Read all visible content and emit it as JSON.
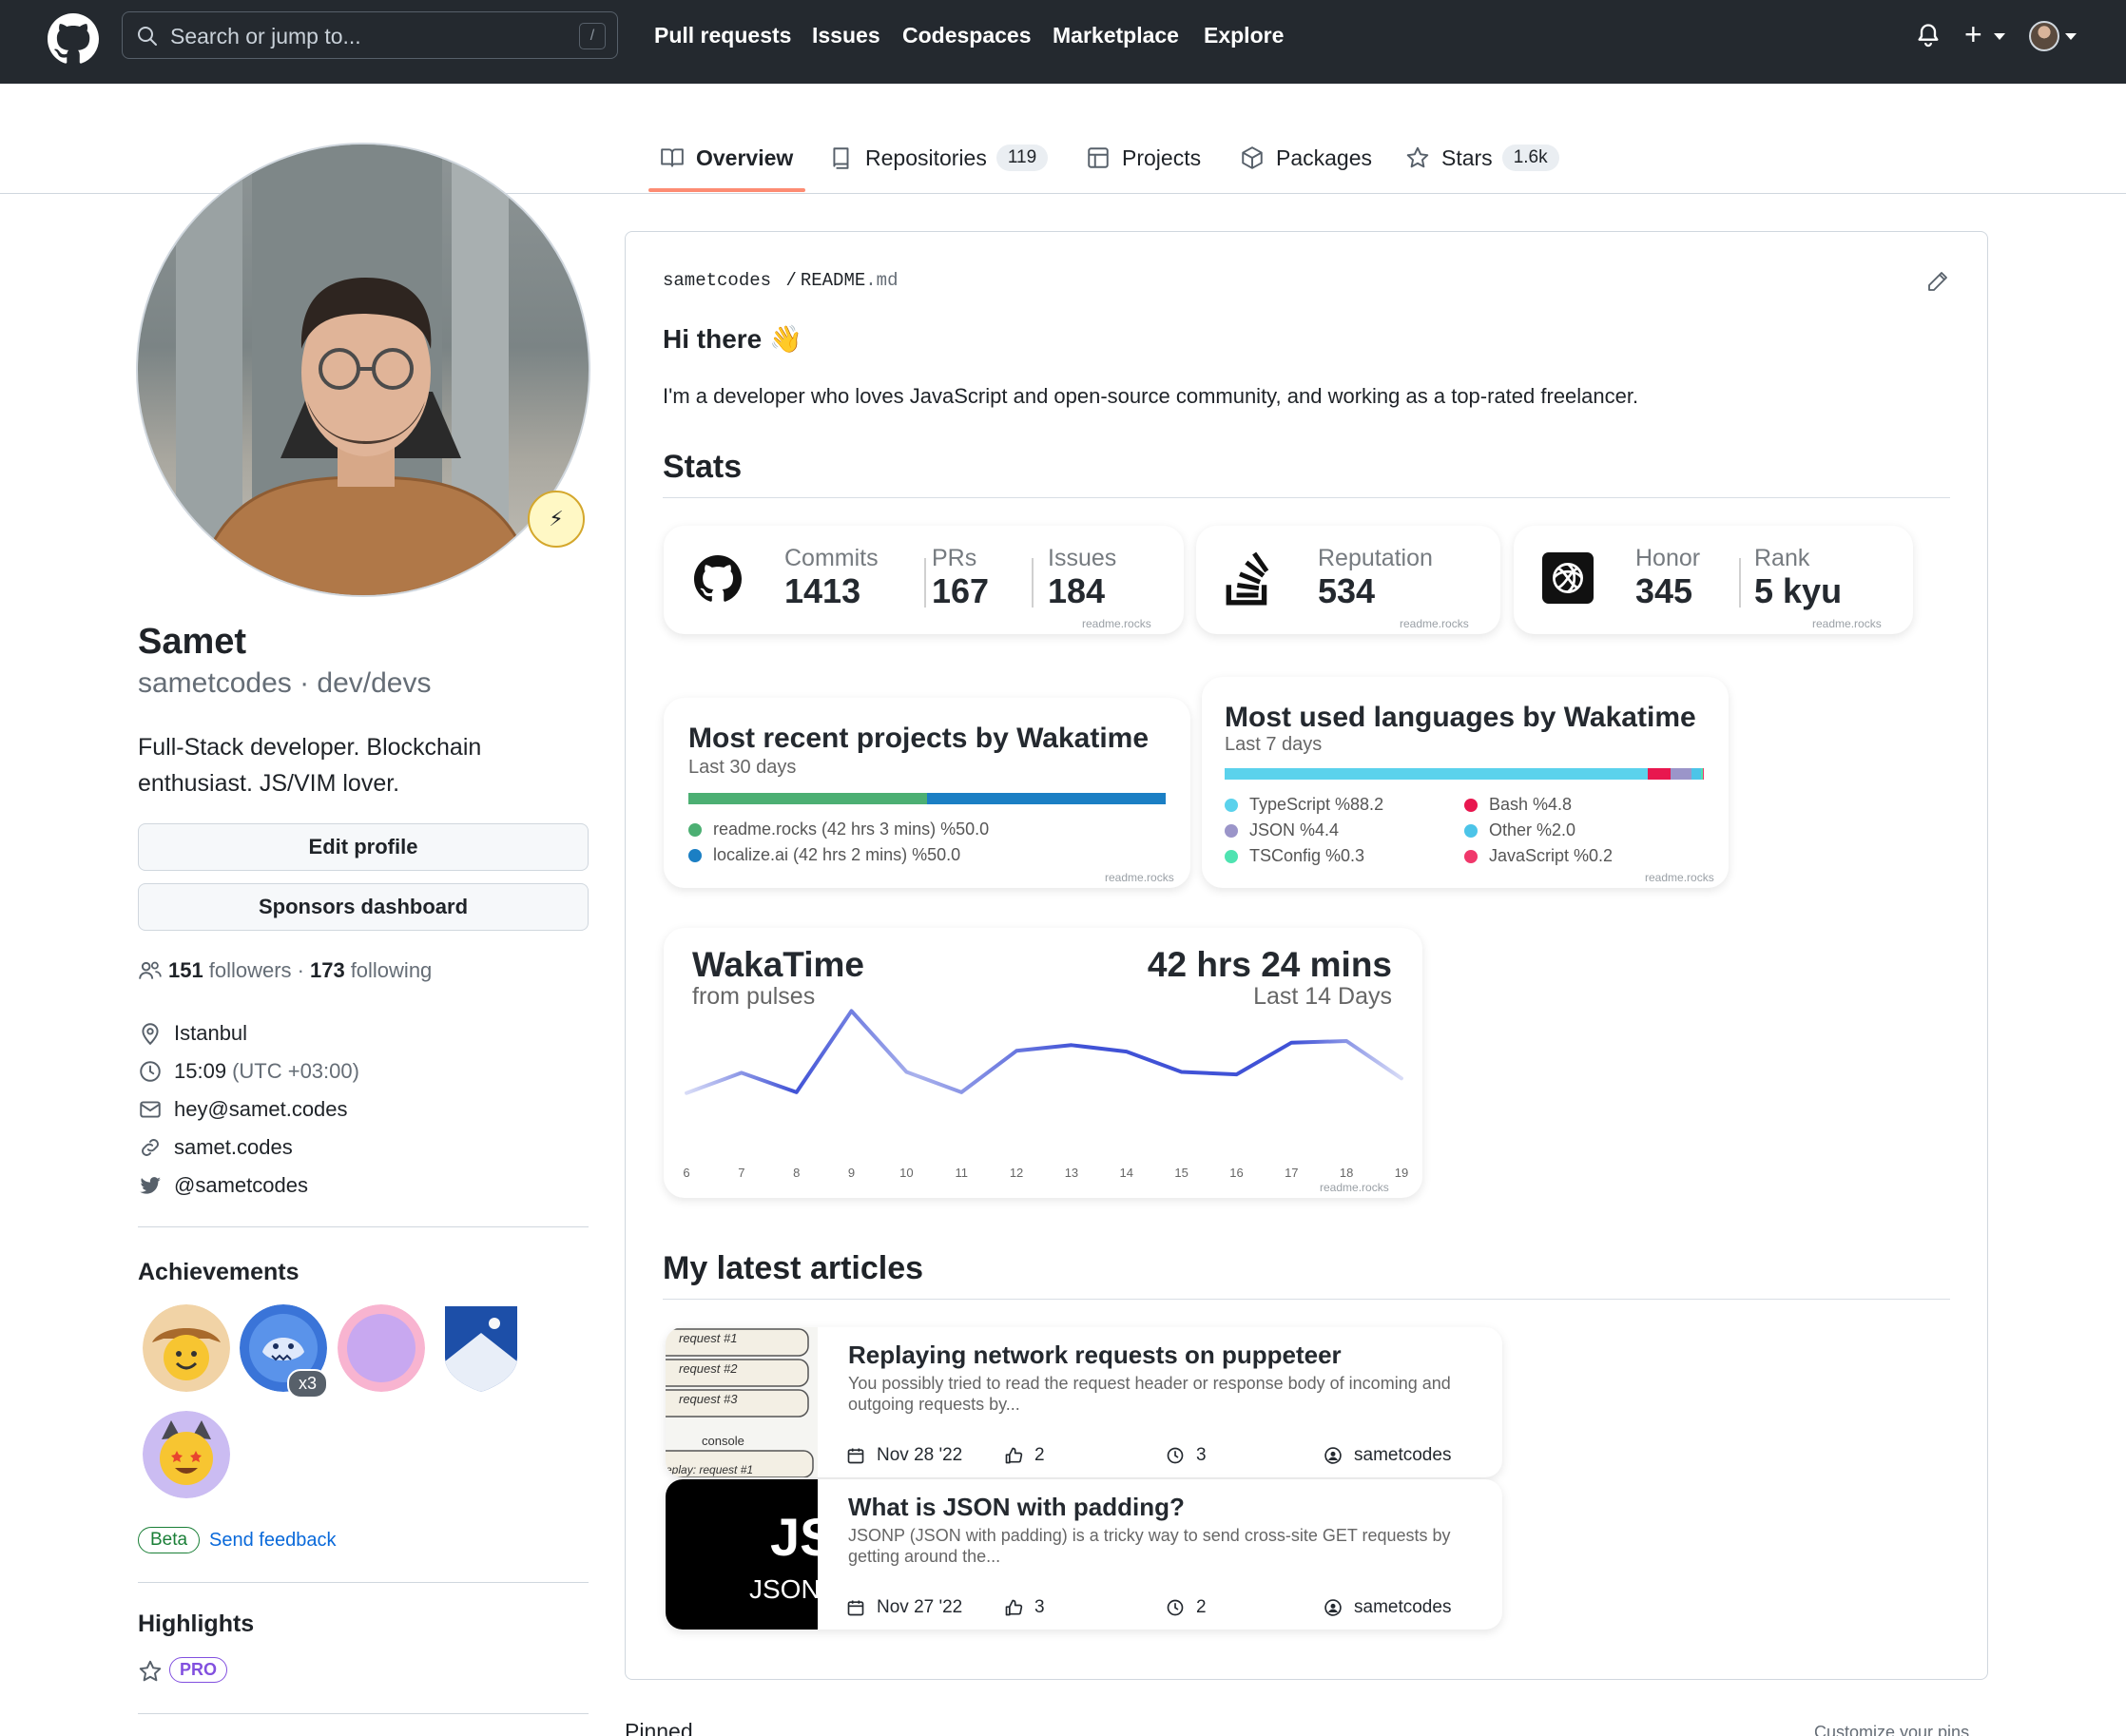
{
  "header": {
    "search_placeholder": "Search or jump to...",
    "slash": "/",
    "nav": [
      "Pull requests",
      "Issues",
      "Codespaces",
      "Marketplace",
      "Explore"
    ],
    "plus": "+"
  },
  "tabs": [
    {
      "label": "Overview"
    },
    {
      "label": "Repositories",
      "count": "119"
    },
    {
      "label": "Projects"
    },
    {
      "label": "Packages"
    },
    {
      "label": "Stars",
      "count": "1.6k"
    }
  ],
  "profile": {
    "name": "Samet",
    "login": "sametcodes · dev/devs",
    "bio": "Full-Stack developer. Blockchain enthusiast. JS/VIM lover.",
    "edit_button": "Edit profile",
    "sponsors_button": "Sponsors dashboard",
    "followers": "151",
    "followers_label": "followers ·",
    "following": "173",
    "following_label": "following",
    "location": "Istanbul",
    "time": "15:09",
    "timezone": "(UTC +03:00)",
    "email": "hey@samet.codes",
    "website": "samet.codes",
    "twitter": "@sametcodes",
    "status_emoji": "⚡"
  },
  "achievements": {
    "title": "Achievements",
    "x3": "x3",
    "beta": "Beta",
    "feedback": "Send feedback"
  },
  "highlights": {
    "title": "Highlights",
    "pro": "PRO"
  },
  "readme": {
    "owner": "sametcodes",
    "sep": "/",
    "file": "README",
    "ext": ".md",
    "greeting": "Hi there 👋",
    "intro": "I'm a developer who loves JavaScript and open-source community, and working as a top-rated freelancer.",
    "stats_heading": "Stats",
    "articles_heading": "My latest articles"
  },
  "stats": {
    "github": [
      {
        "label": "Commits",
        "value": "1413"
      },
      {
        "label": "PRs",
        "value": "167"
      },
      {
        "label": "Issues",
        "value": "184"
      }
    ],
    "stackoverflow": [
      {
        "label": "Reputation",
        "value": "534"
      }
    ],
    "codewars": [
      {
        "label": "Honor",
        "value": "345"
      },
      {
        "label": "Rank",
        "value": "5 kyu"
      }
    ],
    "credit": "readme.rocks"
  },
  "wakatime_projects": {
    "title": "Most recent projects by Wakatime",
    "subtitle": "Last 30 days",
    "items": [
      {
        "label": "readme.rocks (42 hrs 3 mins) %50.0",
        "color": "#4caf73",
        "share": 50.0
      },
      {
        "label": "localize.ai (42 hrs 2 mins) %50.0",
        "color": "#1b7fc4",
        "share": 50.0
      }
    ]
  },
  "wakatime_languages": {
    "title": "Most used languages by Wakatime",
    "subtitle": "Last 7 days",
    "items": [
      {
        "label": "TypeScript %88.2",
        "color": "#5bd2ec",
        "share": 88.2
      },
      {
        "label": "Bash %4.8",
        "color": "#e8174f",
        "share": 4.8
      },
      {
        "label": "JSON %4.4",
        "color": "#9b95c9",
        "share": 4.4
      },
      {
        "label": "Other %2.0",
        "color": "#4cc4e8",
        "share": 2.0
      },
      {
        "label": "TSConfig %0.3",
        "color": "#4fe3b1",
        "share": 0.3
      },
      {
        "label": "JavaScript %0.2",
        "color": "#f0386b",
        "share": 0.2
      }
    ]
  },
  "chart_data": {
    "type": "line",
    "title": "WakaTime",
    "subtitle": "from pulses",
    "total": "42 hrs 24 mins",
    "period": "Last 14 Days",
    "x": [
      6,
      7,
      8,
      9,
      10,
      11,
      12,
      13,
      14,
      15,
      16,
      17,
      18,
      19
    ],
    "values": [
      0.5,
      3.0,
      0.6,
      10.6,
      3.1,
      0.6,
      5.7,
      6.4,
      5.6,
      3.1,
      2.8,
      6.7,
      6.9,
      2.3
    ],
    "ylim": [
      0,
      11
    ],
    "color": "#4052d6",
    "credit": "readme.rocks"
  },
  "articles": [
    {
      "title": "Replaying network requests on puppeteer",
      "desc": "You possibly tried to read the request header or response body of incoming and outgoing requests by...",
      "date": "Nov 28 '22",
      "likes": "2",
      "minutes": "3",
      "author": "sametcodes",
      "thumb": [
        "request #1",
        "request #2",
        "request #3",
        "console",
        "eplay: request #1"
      ]
    },
    {
      "title": "What is JSON with padding?",
      "desc": "JSONP (JSON with padding) is a tricky way to send cross-site GET requests by getting around the...",
      "date": "Nov 27 '22",
      "likes": "3",
      "minutes": "2",
      "author": "sametcodes",
      "thumb": [
        "JS",
        "JSON"
      ]
    }
  ],
  "footer": {
    "pinned": "Pinned",
    "customize": "Customize your pins"
  }
}
